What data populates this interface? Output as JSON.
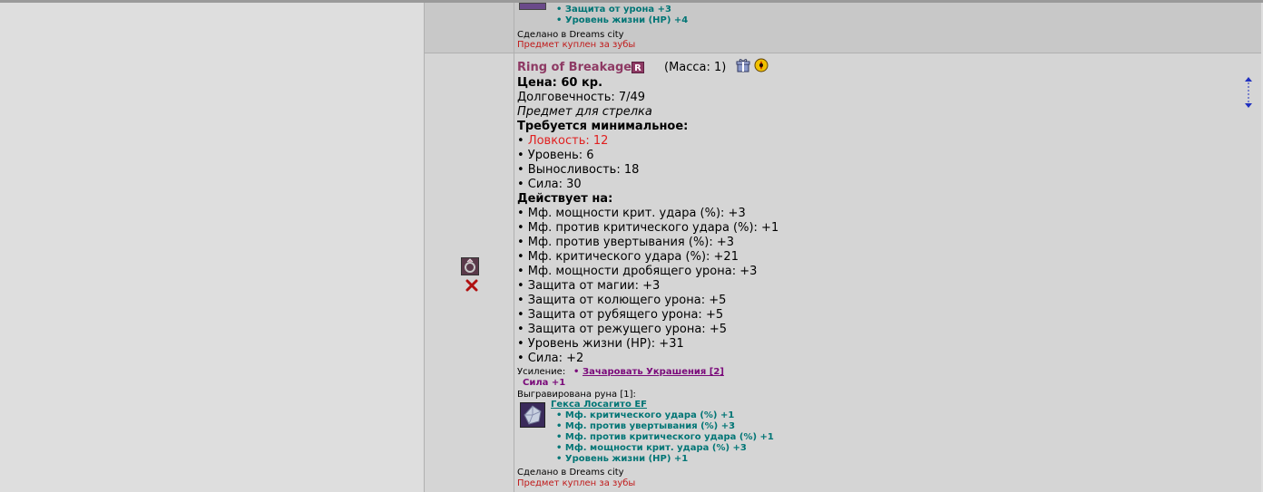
{
  "prev_item": {
    "stats": [
      "• Защита от урона +3",
      "• Уровень жизни (HP) +4"
    ],
    "made_in": "Сделано в Dreams city",
    "bought": "Предмет куплен за зубы"
  },
  "item": {
    "name": "Ring of Breakage",
    "rarity_badge": "R",
    "mass": "(Масса: 1)",
    "price": "Цена: 60 кр.",
    "durability": "Долговечность: 7/49",
    "purpose": "Предмет для стрелка",
    "requires_title": "Требуется минимальное:",
    "requirements": [
      {
        "text": "• Ловкость: 12",
        "unmet": true
      },
      {
        "text": "• Уровень: 6",
        "unmet": false
      },
      {
        "text": "• Выносливость: 18",
        "unmet": false
      },
      {
        "text": "• Сила: 30",
        "unmet": false
      }
    ],
    "effects_title": "Действует на:",
    "effects": [
      "• Мф. мощности крит. удара (%): +3",
      "• Мф. против критического удара (%): +1",
      "• Мф. против увертывания (%): +3",
      "• Мф. критического удара (%): +21",
      "• Мф. мощности дробящего урона: +3",
      "• Защита от магии: +3",
      "• Защита от колющего урона: +5",
      "• Защита от рубящего урона: +5",
      "• Защита от режущего урона: +5",
      "• Уровень жизни (HP): +31",
      "• Сила: +2"
    ],
    "enhance_label": "Усиление:",
    "enhance_link": "Зачаровать Украшения [2]",
    "enhance_bonus": "Сила +1",
    "rune_label": "Выгравирована руна [1]:",
    "rune_name": "Гекса Лосагито EF",
    "rune_stats": [
      "• Мф. критического удара (%) +1",
      "• Мф. против увертывания (%) +3",
      "• Мф. против критического удара (%) +1",
      "• Мф. мощности крит. удара (%) +3",
      "• Уровень жизни (HP) +1"
    ],
    "made_in": "Сделано в Dreams city",
    "bought": "Предмет куплен за зубы"
  },
  "colors": {
    "title": "#8e3a64",
    "unmet": "#e02020",
    "teal": "#007575",
    "link": "#7a0a7a",
    "bought": "#c01a1a"
  },
  "icons": [
    "gift-icon",
    "repair-icon",
    "ring-icon",
    "delete-icon",
    "scroll-arrows-icon",
    "rune-icon"
  ]
}
